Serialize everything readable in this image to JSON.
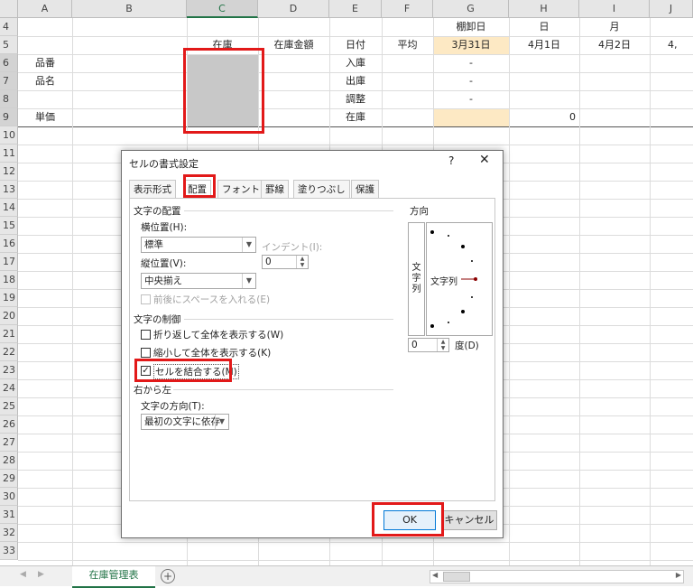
{
  "columns": [
    "A",
    "B",
    "C",
    "D",
    "E",
    "F",
    "G",
    "H",
    "I",
    "J"
  ],
  "rows": [
    "4",
    "5",
    "6",
    "7",
    "8",
    "9",
    "10",
    "11",
    "12",
    "13",
    "14",
    "15",
    "16",
    "17",
    "18",
    "19",
    "20",
    "21",
    "22",
    "23",
    "24",
    "25",
    "26",
    "27",
    "28",
    "29",
    "30",
    "31",
    "32",
    "33"
  ],
  "cells": {
    "g4": "棚卸日",
    "h4": "日",
    "i4": "月",
    "c5": "在庫",
    "d5": "在庫金額",
    "e5": "日付",
    "f5": "平均",
    "g5": "3月31日",
    "h5": "4月1日",
    "i5": "4月2日",
    "j5": "4,",
    "a6": "品番",
    "e6": "入庫",
    "g6": "-",
    "a7": "品名",
    "e7": "出庫",
    "g7": "-",
    "e8": "調整",
    "g8": "-",
    "a9": "単価",
    "e9": "在庫",
    "h9": "0"
  },
  "sheet_tab": "在庫管理表",
  "add_sheet": "+",
  "dialog": {
    "title": "セルの書式設定",
    "help": "?",
    "close": "✕",
    "tabs": [
      "表示形式",
      "配置",
      "フォント",
      "罫線",
      "塗りつぶし",
      "保護"
    ],
    "active_tab": "配置",
    "alignment_group": "文字の配置",
    "horizontal_label": "横位置(H):",
    "horizontal_value": "標準",
    "indent_label": "インデント(I):",
    "indent_value": "0",
    "vertical_label": "縦位置(V):",
    "vertical_value": "中央揃え",
    "justify_distributed": "前後にスペースを入れる(E)",
    "control_group": "文字の制御",
    "wrap_text": "折り返して全体を表示する(W)",
    "shrink_to_fit": "縮小して全体を表示する(K)",
    "merge_cells": "セルを結合する(M)",
    "merge_checked": true,
    "rtl_group": "右から左",
    "direction_label": "文字の方向(T):",
    "direction_value": "最初の文字に依存",
    "orientation_group": "方向",
    "vertical_text": "文字列",
    "orientation_text": "文字列",
    "degrees_value": "0",
    "degrees_label": "度(D)",
    "ok": "OK",
    "cancel": "キャンセル"
  },
  "colors": {
    "highlight_red": "#e21919",
    "excel_green": "#217346",
    "merged_gray": "#c8c8c8",
    "date_yellow": "#fde9c4"
  }
}
